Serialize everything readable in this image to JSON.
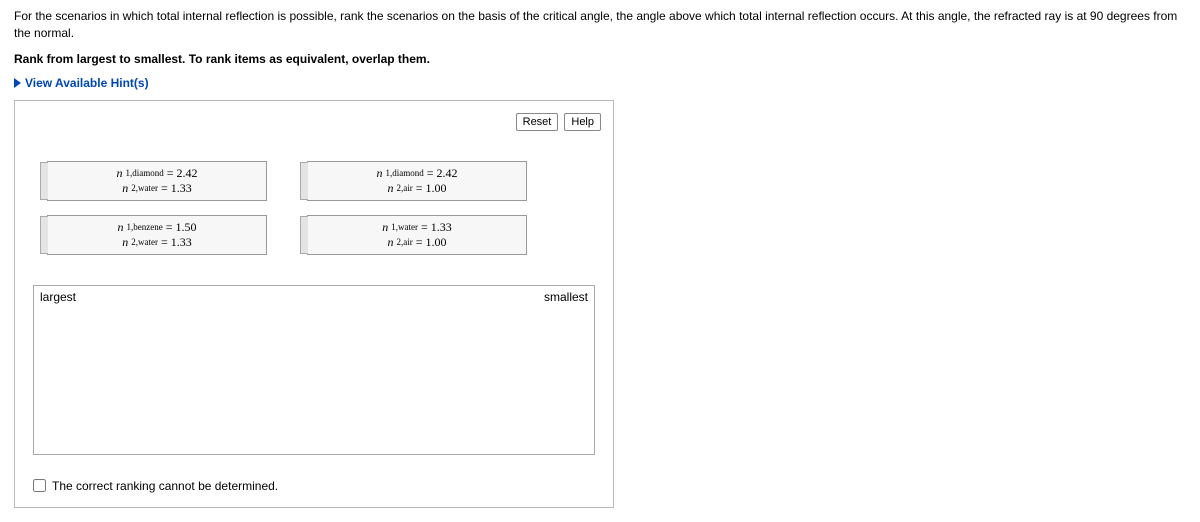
{
  "intro": "For the scenarios in which total internal reflection is possible, rank the scenarios on the basis of the critical angle, the angle above which total internal reflection occurs. At this angle, the refracted ray is at 90 degrees from the normal.",
  "rank_instr": "Rank from largest to smallest. To rank items as equivalent, overlap them.",
  "hints_label": "View Available Hint(s)",
  "toolbar": {
    "reset": "Reset",
    "help": "Help"
  },
  "cards": [
    [
      {
        "line1_var": "n",
        "line1_sub": "1,diamond",
        "line1_val": "2.42",
        "line2_var": "n",
        "line2_sub": "2,water",
        "line2_val": "1.33"
      },
      {
        "line1_var": "n",
        "line1_sub": "1,diamond",
        "line1_val": "2.42",
        "line2_var": "n",
        "line2_sub": "2,air",
        "line2_val": "1.00"
      }
    ],
    [
      {
        "line1_var": "n",
        "line1_sub": "1,benzene",
        "line1_val": "1.50",
        "line2_var": "n",
        "line2_sub": "2,water",
        "line2_val": "1.33"
      },
      {
        "line1_var": "n",
        "line1_sub": "1,water",
        "line1_val": "1.33",
        "line2_var": "n",
        "line2_sub": "2,air",
        "line2_val": "1.00"
      }
    ]
  ],
  "target": {
    "largest": "largest",
    "smallest": "smallest"
  },
  "cannot_label": "The correct ranking cannot be determined."
}
